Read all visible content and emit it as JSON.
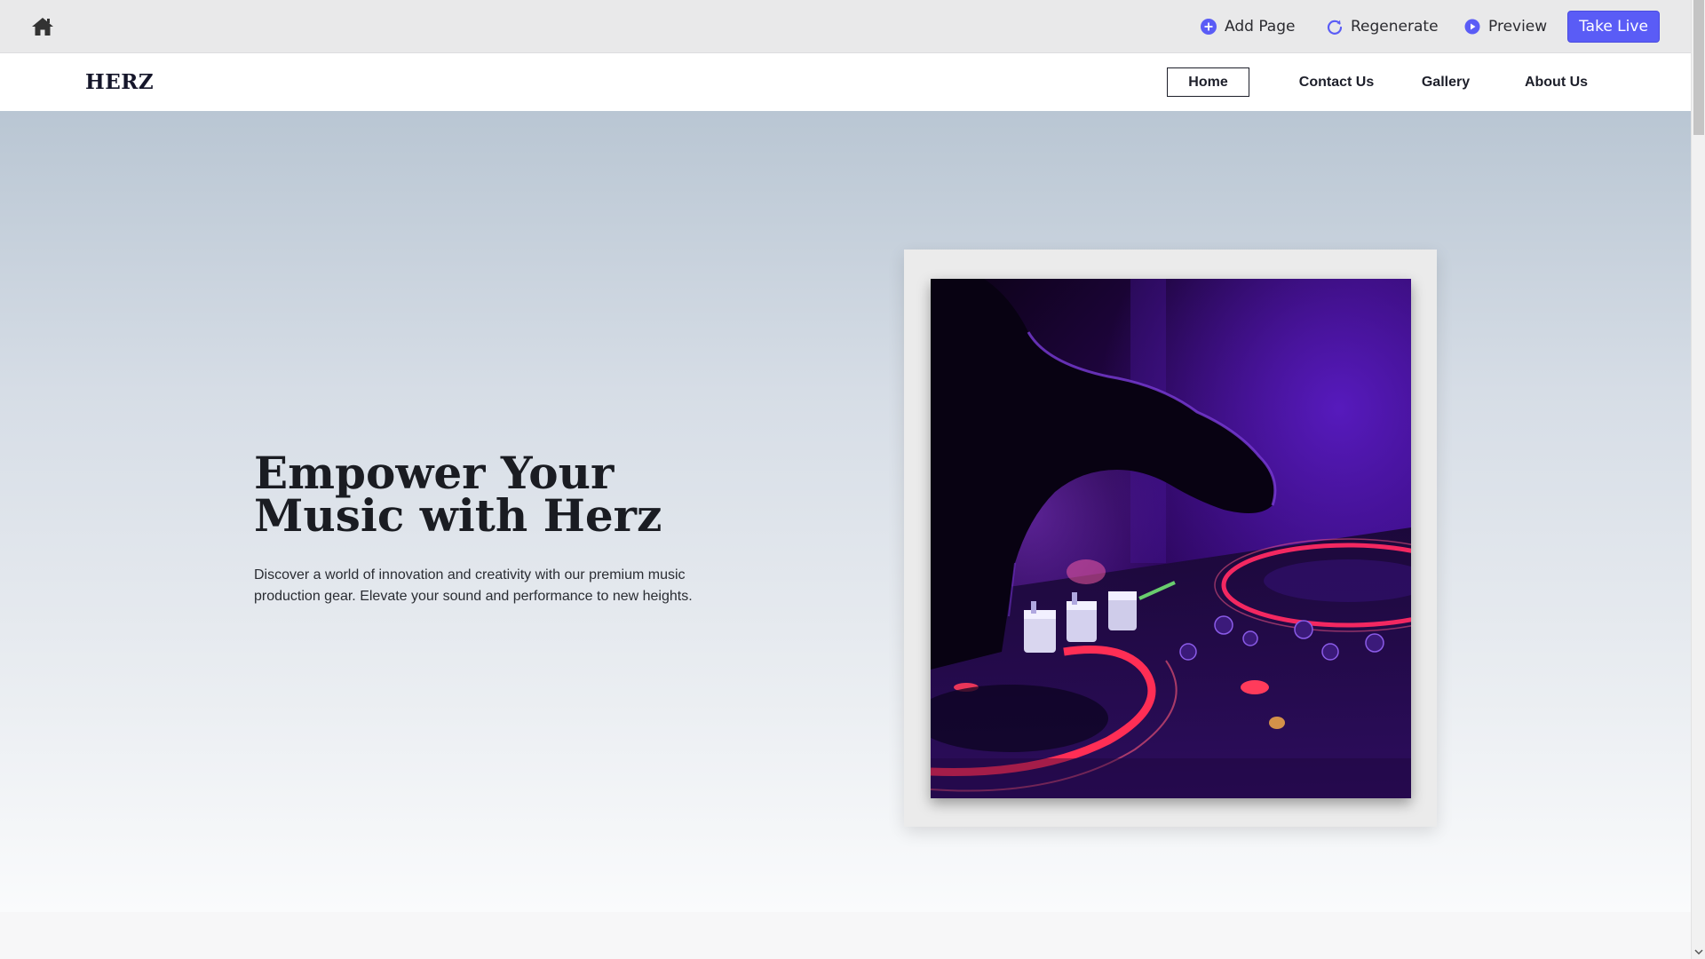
{
  "toolbar": {
    "home_icon": "home-icon",
    "add_page": "Add Page",
    "regenerate": "Regenerate",
    "preview": "Preview",
    "take_live": "Take Live",
    "accent": "#5a5cf6"
  },
  "site": {
    "logo": "HERZ",
    "nav": [
      {
        "label": "Home",
        "active": true
      },
      {
        "label": "Contact Us",
        "active": false
      },
      {
        "label": "Gallery",
        "active": false
      },
      {
        "label": "About Us",
        "active": false
      }
    ]
  },
  "hero": {
    "title": "Empower Your Music with Herz",
    "text": "Discover a world of innovation and creativity with our premium music production gear. Elevate your sound and performance to new heights.",
    "image": "dj-controller-photo"
  }
}
